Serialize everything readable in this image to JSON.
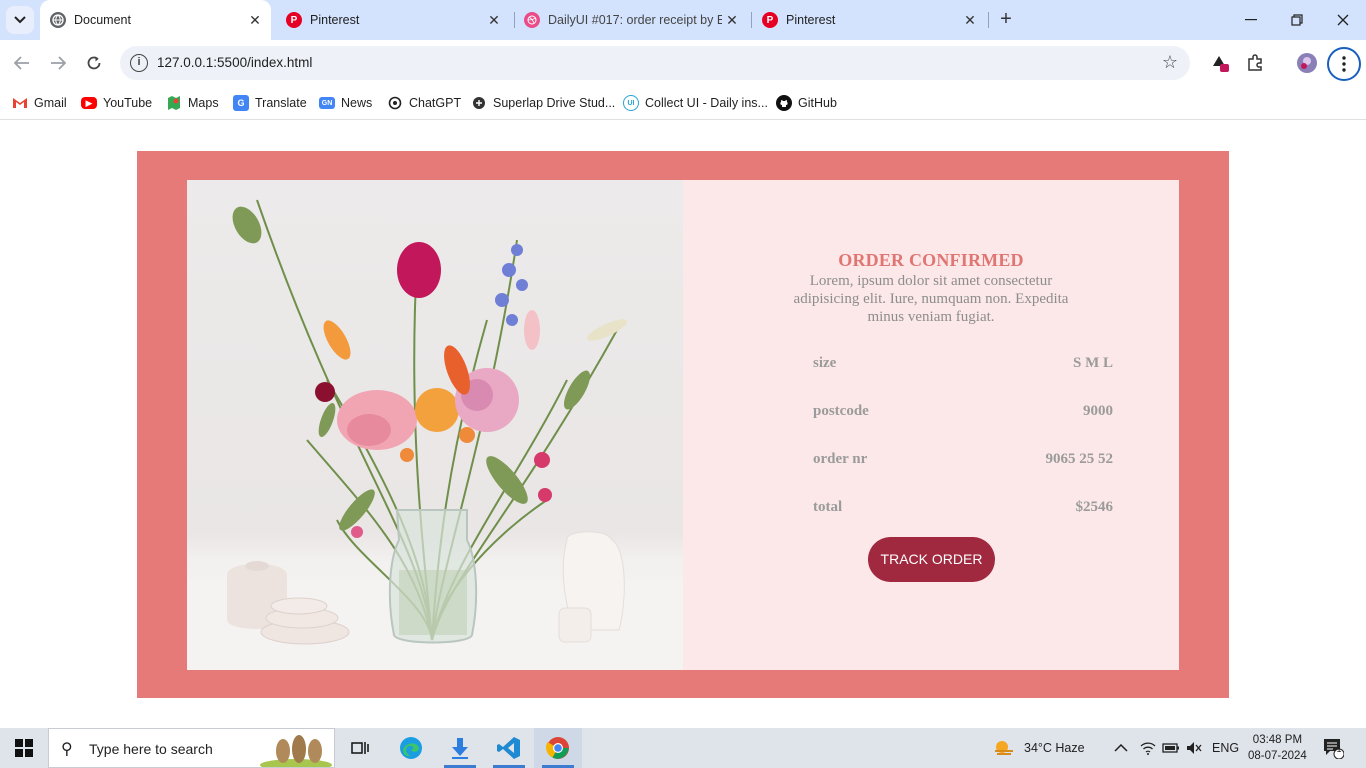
{
  "browser": {
    "tabs": [
      {
        "title": "Document",
        "active": true,
        "icon": "globe-icon"
      },
      {
        "title": "Pinterest",
        "active": false,
        "icon": "pinterest-icon"
      },
      {
        "title": "DailyUI #017: order receipt by E",
        "active": false,
        "icon": "dribbble-icon"
      },
      {
        "title": "Pinterest",
        "active": false,
        "icon": "pinterest-icon"
      }
    ],
    "url": "127.0.0.1:5500/index.html",
    "bookmarks": [
      {
        "label": "Gmail",
        "icon": "gmail-icon",
        "color": "#ea4335"
      },
      {
        "label": "YouTube",
        "icon": "youtube-icon",
        "color": "#ff0000"
      },
      {
        "label": "Maps",
        "icon": "maps-icon",
        "color": "#34a853"
      },
      {
        "label": "Translate",
        "icon": "translate-icon",
        "color": "#4285f4"
      },
      {
        "label": "News",
        "icon": "news-icon",
        "color": "#4285f4"
      },
      {
        "label": "ChatGPT",
        "icon": "chatgpt-icon",
        "color": "#222222"
      },
      {
        "label": "Superlap Drive Stud...",
        "icon": "superlap-icon",
        "color": "#333333"
      },
      {
        "label": "Collect UI - Daily ins...",
        "icon": "collectui-icon",
        "color": "#2aa4d8"
      },
      {
        "label": "GitHub",
        "icon": "github-icon",
        "color": "#111111"
      }
    ]
  },
  "page": {
    "frame_color": "#e57a78",
    "card_color": "#fce8e8",
    "accent_color": "#e07572",
    "button_color": "#a0293f",
    "image_alt": "flower-vase-photo",
    "heading": "ORDER CONFIRMED",
    "description": "Lorem, ipsum dolor sit amet consectetur adipisicing elit. Iure, numquam non. Expedita minus veniam fugiat.",
    "details": [
      {
        "label": "size",
        "value": "S M L"
      },
      {
        "label": "postcode",
        "value": "9000"
      },
      {
        "label": "order nr",
        "value": "9065 25 52"
      },
      {
        "label": "total",
        "value": "$2546"
      }
    ],
    "button_label": "TRACK ORDER"
  },
  "taskbar": {
    "search_placeholder": "Type here to search",
    "weather": "34°C  Haze",
    "language": "ENG",
    "time": "03:48 PM",
    "date": "08-07-2024",
    "notification_count": "1"
  }
}
